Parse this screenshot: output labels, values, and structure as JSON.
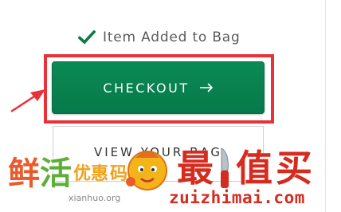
{
  "confirmation": {
    "icon": "checkmark-icon",
    "text": "Item Added to Bag",
    "check_color": "#0b7a4b"
  },
  "checkout": {
    "label": "CHECKOUT",
    "arrow_icon": "right-arrow-icon",
    "background_color": "#0b8a54",
    "text_color": "#ffffff"
  },
  "view_bag": {
    "label": "VIEW YOUR BAG"
  },
  "annotation": {
    "highlight_color": "#e7323a",
    "arrow_icon": "pointer-arrow-icon"
  },
  "watermark": {
    "left_chars": [
      "鲜",
      "活",
      "优惠",
      "码"
    ],
    "left_sub": "xianhuo.org",
    "right_chars": [
      "最",
      "值",
      "买"
    ],
    "domain": "zuizhimai.com",
    "brand_red": "#d62b1f",
    "brand_orange": "#ec5a2b",
    "brand_green": "#5fae3a"
  }
}
